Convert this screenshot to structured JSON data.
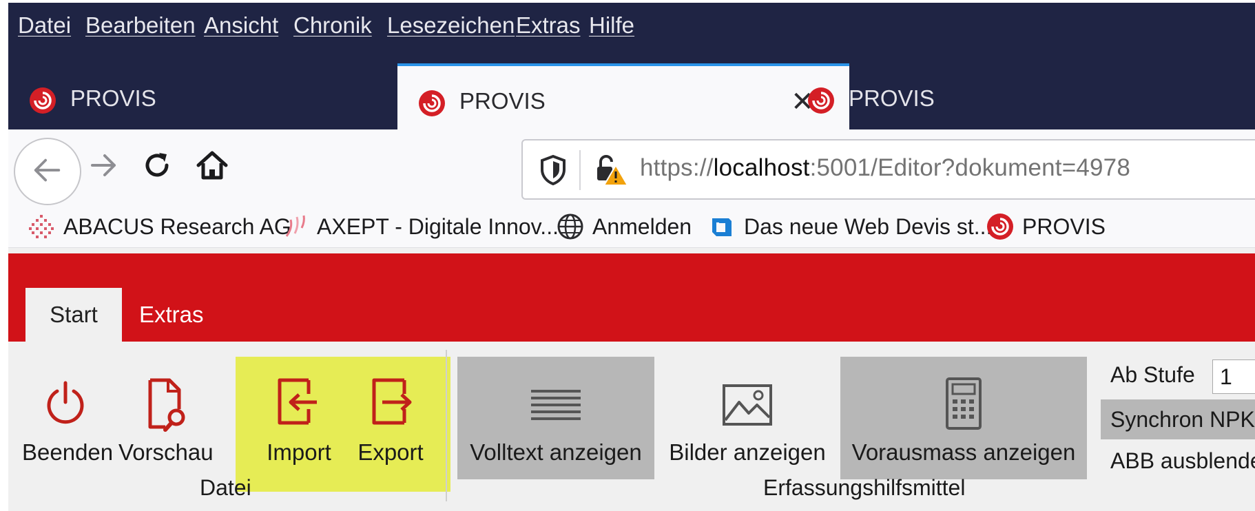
{
  "menu": {
    "items": [
      "Datei",
      "Bearbeiten",
      "Ansicht",
      "Chronik",
      "Lesezeichen",
      "Extras",
      "Hilfe"
    ]
  },
  "tabs": [
    {
      "label": "PROVIS",
      "state": "inactive"
    },
    {
      "label": "PROVIS",
      "state": "active"
    },
    {
      "label": "PROVIS",
      "state": "inactive"
    }
  ],
  "tab_close_glyph": "✕",
  "urlbar": {
    "scheme": "https://",
    "host": "localhost",
    "rest": ":5001/Editor?dokument=4978"
  },
  "bookmarks": [
    {
      "label": "ABACUS Research AG",
      "icon": "abacus-icon"
    },
    {
      "label": "AXEPT - Digitale Innov...",
      "icon": "axept-icon"
    },
    {
      "label": "Anmelden",
      "icon": "globe-icon"
    },
    {
      "label": "Das neue Web Devis st...",
      "icon": "devis-icon"
    },
    {
      "label": "PROVIS",
      "icon": "provis-icon"
    }
  ],
  "app": {
    "tabs": [
      "Start",
      "Extras"
    ],
    "active_tab": "Start"
  },
  "ribbon": {
    "datei": {
      "group_label": "Datei",
      "buttons": [
        "Beenden",
        "Vorschau",
        "Import",
        "Export"
      ]
    },
    "erfassung": {
      "group_label": "Erfassungshilfsmittel",
      "buttons": [
        "Volltext anzeigen",
        "Bilder anzeigen",
        "Vorausmass anzeigen"
      ]
    },
    "right": {
      "ab_stufe_label": "Ab Stufe",
      "ab_stufe_value": "1",
      "synchron_label": "Synchron NPK",
      "abb_label": "ABB ausblenden"
    }
  },
  "colors": {
    "titlebar": "#1f2444",
    "accent_tab": "#2a93e8",
    "app_red": "#d11218",
    "highlight": "#e6ec55",
    "pressed": "#b7b7b7",
    "icon_red": "#c0211a"
  }
}
